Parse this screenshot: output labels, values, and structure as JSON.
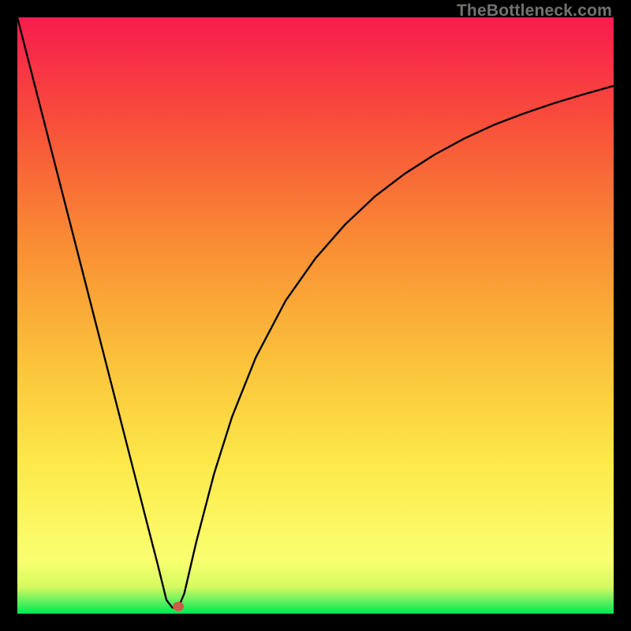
{
  "watermark": "TheBottleneck.com",
  "chart_data": {
    "type": "line",
    "title": "",
    "xlabel": "",
    "ylabel": "",
    "xlim": [
      0,
      100
    ],
    "ylim": [
      0,
      100
    ],
    "x": [
      0,
      3,
      6,
      9,
      12,
      15,
      18,
      20,
      22,
      23.5,
      25,
      26,
      27,
      28,
      30,
      33,
      36,
      40,
      45,
      50,
      55,
      60,
      65,
      70,
      75,
      80,
      85,
      90,
      95,
      100
    ],
    "values": [
      100,
      88.3,
      76.6,
      64.9,
      53.2,
      41.5,
      29.8,
      22.0,
      14.2,
      8.4,
      2.3,
      1.0,
      1.0,
      3.4,
      12.0,
      23.5,
      33.0,
      43.0,
      52.5,
      59.6,
      65.3,
      70.0,
      73.8,
      77.0,
      79.7,
      82.0,
      83.9,
      85.6,
      87.1,
      88.5
    ],
    "marker": {
      "x": 27,
      "y": 1.2
    },
    "bands": [
      {
        "name": "green",
        "y0": 0.0,
        "y1": 2.0,
        "c0": "#00e850",
        "c1": "#5ef05e"
      },
      {
        "name": "lightgreen",
        "y0": 2.0,
        "y1": 4.5,
        "c0": "#5ef05e",
        "c1": "#d6fa60"
      },
      {
        "name": "paleyellow",
        "y0": 4.5,
        "y1": 9.0,
        "c0": "#d6fa60",
        "c1": "#faff70"
      },
      {
        "name": "yellow",
        "y0": 9.0,
        "y1": 25.0,
        "c0": "#faff70",
        "c1": "#fde94a"
      },
      {
        "name": "yellow2",
        "y0": 25.0,
        "y1": 42.0,
        "c0": "#fde94a",
        "c1": "#fbc33b"
      },
      {
        "name": "orange",
        "y0": 42.0,
        "y1": 62.0,
        "c0": "#fbc33b",
        "c1": "#f98d34"
      },
      {
        "name": "orange2",
        "y0": 62.0,
        "y1": 82.0,
        "c0": "#f98d34",
        "c1": "#f8503a"
      },
      {
        "name": "red",
        "y0": 82.0,
        "y1": 100.0,
        "c0": "#f8503a",
        "c1": "#f71c4e"
      }
    ]
  }
}
